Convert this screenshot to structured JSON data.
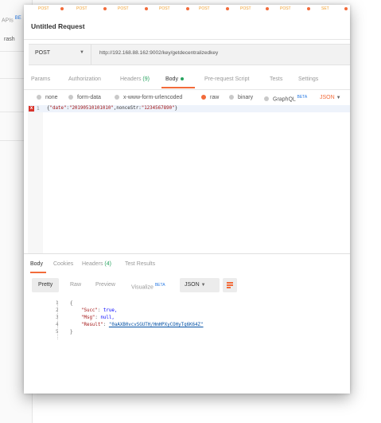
{
  "background_app": {
    "sidebar_label": "APIs",
    "sidebar_badge": "BE",
    "sidebar_item": "rash"
  },
  "tab_strip": {
    "tabs": [
      "POST",
      "POST",
      "POST",
      "POST",
      "POST",
      "POST",
      "POST",
      "POST",
      "SET"
    ]
  },
  "request": {
    "title": "Untitled Request",
    "method": "POST",
    "url": "http://192.168.88.162:9002/key/getdecentralizedkey"
  },
  "request_tabs": {
    "params": "Params",
    "authorization": "Authorization",
    "headers": "Headers",
    "headers_count": "(9)",
    "body": "Body",
    "pre_request": "Pre-request Script",
    "tests": "Tests",
    "settings": "Settings"
  },
  "body_options": {
    "none": "none",
    "form_data": "form-data",
    "urlencoded": "x-www-form-urlencoded",
    "raw": "raw",
    "binary": "binary",
    "graphql": "GraphQL",
    "graphql_badge": "BETA",
    "format": "JSON",
    "selected": "raw"
  },
  "request_body": {
    "line_number": "1",
    "error_marker": "x",
    "prefix": "{",
    "key1": "\"date\"",
    "sep1": ":",
    "val1": "\"20190510101010\"",
    "sep2": ",nonceStr:",
    "val2": "\"1234567890\"",
    "suffix": "}"
  },
  "response_tabs": {
    "body": "Body",
    "cookies": "Cookies",
    "headers": "Headers",
    "headers_count": "(4)",
    "test_results": "Test Results"
  },
  "response_toolbar": {
    "pretty": "Pretty",
    "raw": "Raw",
    "preview": "Preview",
    "visualize": "Visualize",
    "visualize_badge": "BETA",
    "format": "JSON"
  },
  "response_body": {
    "lines": [
      {
        "n": "1",
        "text": "{"
      },
      {
        "n": "2",
        "key": "\"Succ\"",
        "value": "true,"
      },
      {
        "n": "3",
        "key": "\"Msg\"",
        "value": "null,"
      },
      {
        "n": "4",
        "key": "\"Result\"",
        "value": "\"0aAXB0vcvSGUTH/HmHPXyCOHyTq6K64Z\""
      },
      {
        "n": "5",
        "text": "}"
      }
    ]
  },
  "colors": {
    "accent": "#f26b3a",
    "success": "#27a35f",
    "error": "#d9342b",
    "beta": "#2a7be4"
  }
}
